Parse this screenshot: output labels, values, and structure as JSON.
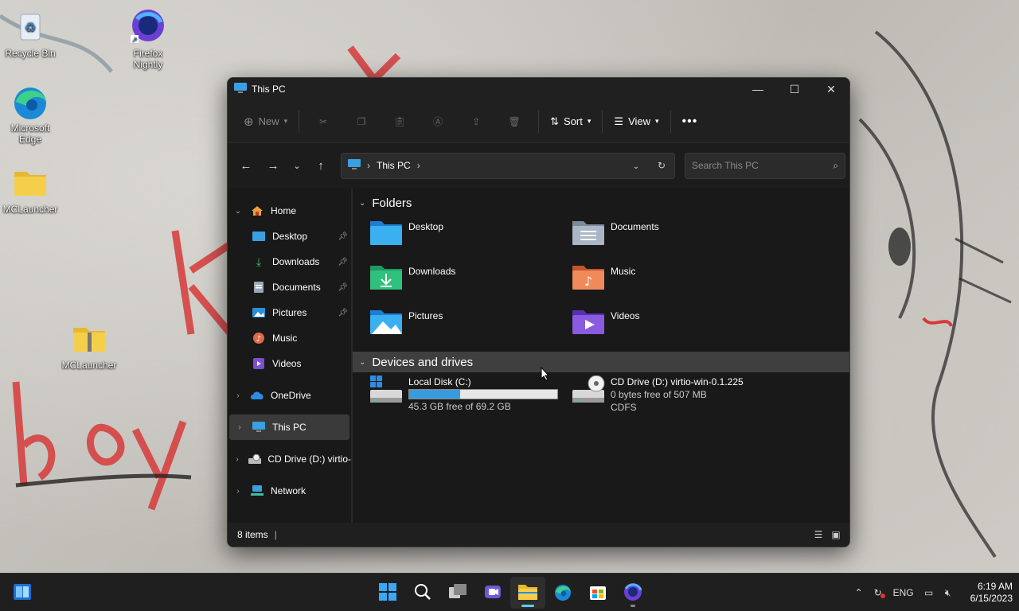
{
  "desktop": {
    "icons": [
      {
        "label": "Recycle Bin"
      },
      {
        "label": "Firefox Nightly"
      },
      {
        "label": "Microsoft Edge"
      },
      {
        "label": "MCLauncher"
      },
      {
        "label": "MCLauncher"
      }
    ]
  },
  "window": {
    "title": "This PC",
    "toolbar": {
      "new_label": "New",
      "sort_label": "Sort",
      "view_label": "View"
    },
    "address": {
      "segment": "This PC"
    },
    "search": {
      "placeholder": "Search This PC"
    },
    "sidebar": {
      "items": [
        {
          "label": "Home"
        },
        {
          "label": "Desktop"
        },
        {
          "label": "Downloads"
        },
        {
          "label": "Documents"
        },
        {
          "label": "Pictures"
        },
        {
          "label": "Music"
        },
        {
          "label": "Videos"
        },
        {
          "label": "OneDrive"
        },
        {
          "label": "This PC"
        },
        {
          "label": "CD Drive (D:) virtio-w"
        },
        {
          "label": "Network"
        }
      ]
    },
    "folders_header": "Folders",
    "folders": [
      {
        "name": "Desktop"
      },
      {
        "name": "Documents"
      },
      {
        "name": "Downloads"
      },
      {
        "name": "Music"
      },
      {
        "name": "Pictures"
      },
      {
        "name": "Videos"
      }
    ],
    "drives_header": "Devices and drives",
    "drives": [
      {
        "name": "Local Disk (C:)",
        "free_text": "45.3 GB free of 69.2 GB",
        "used_fraction": 0.345
      },
      {
        "name": "CD Drive (D:) virtio-win-0.1.225",
        "free_text": "0 bytes free of 507 MB",
        "fs": "CDFS"
      }
    ],
    "status": {
      "items_count": "8 items"
    }
  },
  "taskbar": {
    "language": "ENG",
    "time": "6:19 AM",
    "date": "6/15/2023"
  }
}
